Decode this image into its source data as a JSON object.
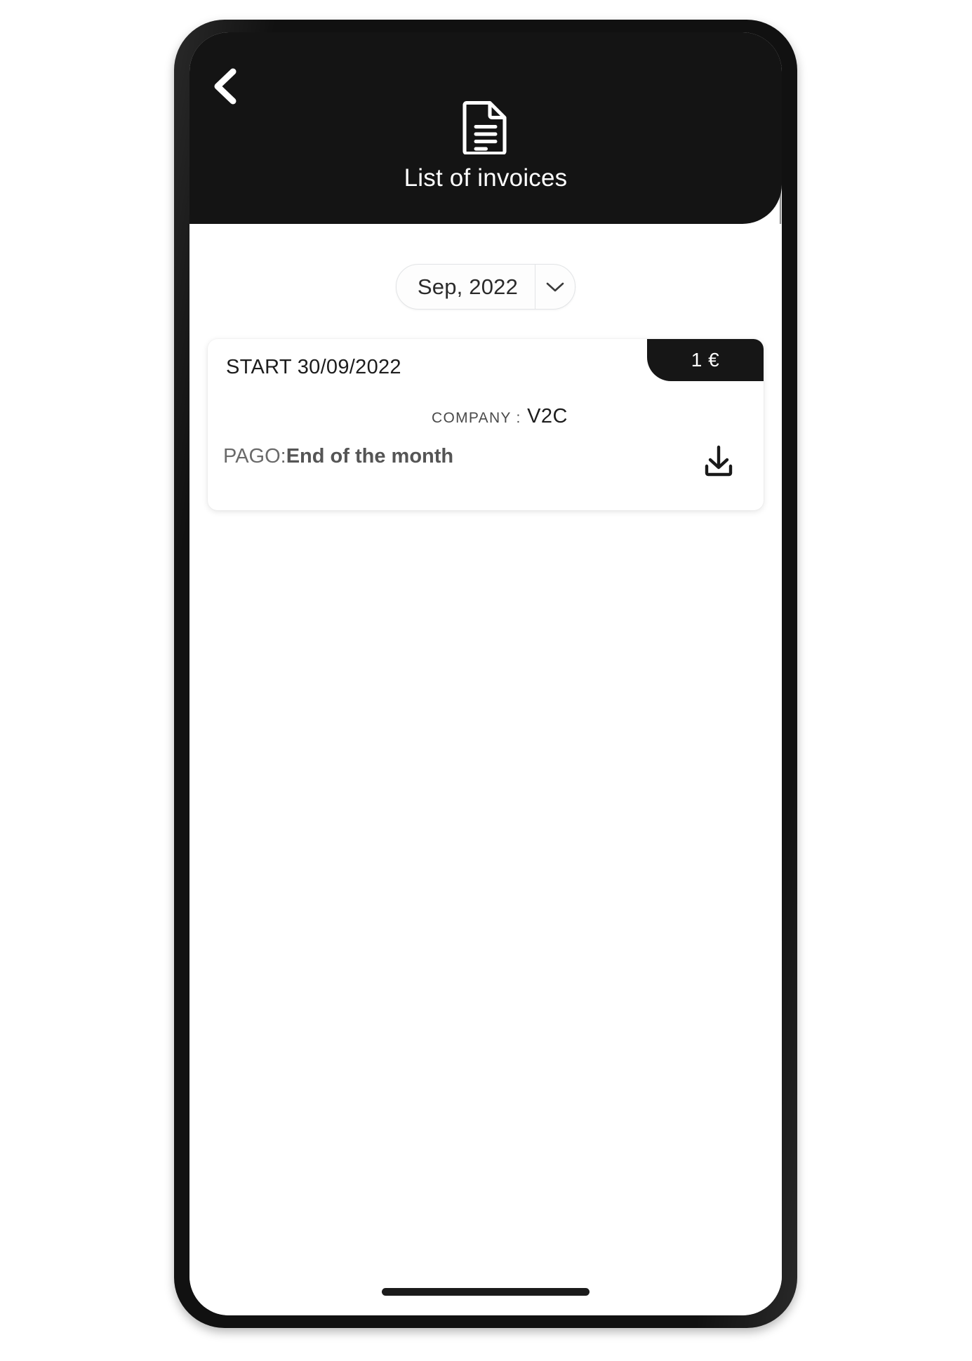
{
  "header": {
    "back_icon": "chevron-left-icon",
    "doc_icon": "document-icon",
    "title": "List of invoices"
  },
  "filter": {
    "month_value": "Sep, 2022",
    "chevron_icon": "chevron-down-icon"
  },
  "invoices": [
    {
      "start_label": "START 30/09/2022",
      "amount": "1 €",
      "company_label": "COMPANY :",
      "company_value": "V2C",
      "payment_label": "PAGO:",
      "payment_value": "End of the month",
      "download_icon": "download-icon"
    }
  ],
  "colors": {
    "header_bg": "#141414",
    "badge_bg": "#161616",
    "screen_bg": "#ffffff",
    "bezel": "#111111",
    "text_primary": "#1d1d1d",
    "text_muted": "#6a6a6a"
  },
  "system": {
    "home_indicator": "home-indicator"
  }
}
